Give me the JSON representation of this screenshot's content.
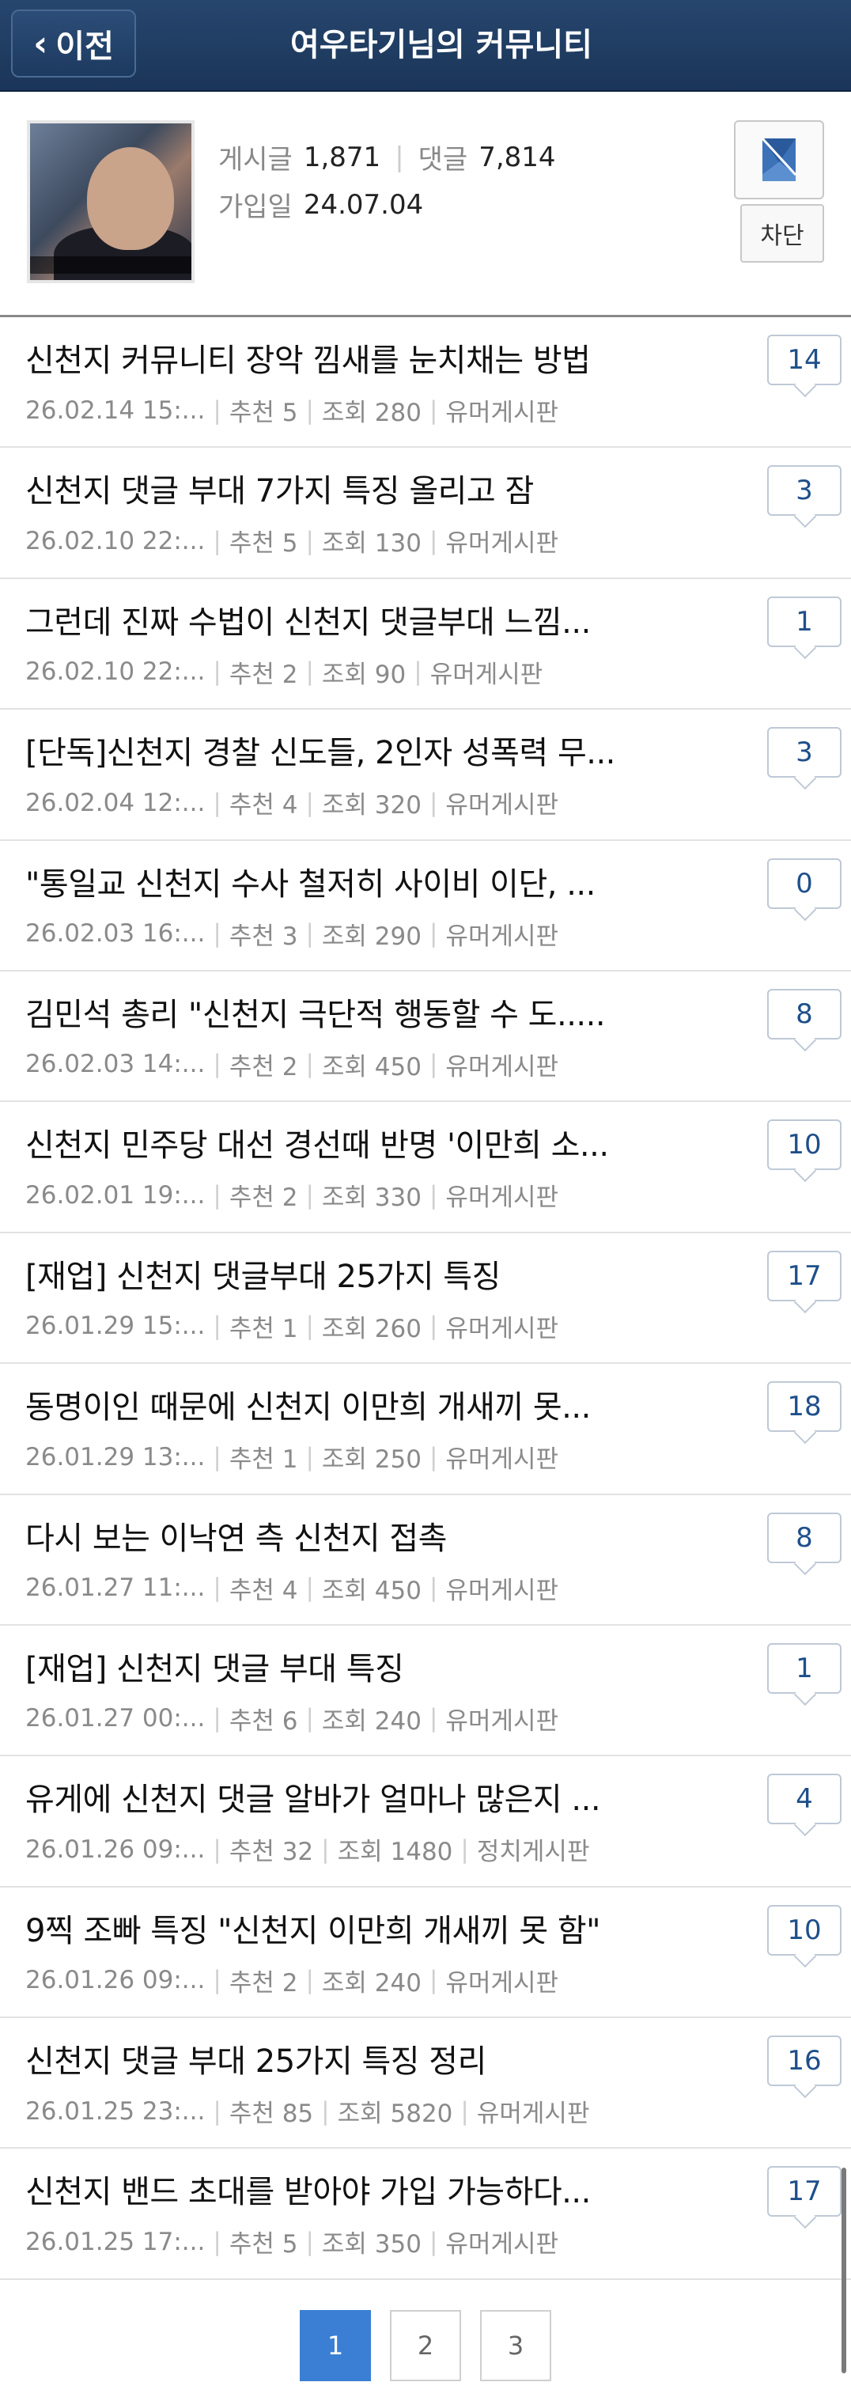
{
  "header": {
    "back_label": "이전",
    "title": "여우타기님의 커뮤니티"
  },
  "profile": {
    "posts_label": "게시글",
    "posts_count": "1,871",
    "comments_label": "댓글",
    "comments_count": "7,814",
    "joined_label": "가입일",
    "joined_date": "24.07.04",
    "block_label": "차단"
  },
  "posts": [
    {
      "title": "신천지 커뮤니티 장악 낌새를 눈치채는 방법",
      "date": "26.02.14  15:...",
      "likes": "추천 5",
      "views": "조회 280",
      "board": "유머게시판",
      "comments": "14"
    },
    {
      "title": "신천지 댓글 부대 7가지 특징 올리고 잠",
      "date": "26.02.10  22:...",
      "likes": "추천 5",
      "views": "조회 130",
      "board": "유머게시판",
      "comments": "3"
    },
    {
      "title": "그런데 진짜 수법이 신천지 댓글부대 느낌...",
      "date": "26.02.10  22:...",
      "likes": "추천 2",
      "views": "조회 90",
      "board": "유머게시판",
      "comments": "1"
    },
    {
      "title": "[단독]신천지 경찰 신도들, 2인자 성폭력 무...",
      "date": "26.02.04  12:...",
      "likes": "추천 4",
      "views": "조회 320",
      "board": "유머게시판",
      "comments": "3"
    },
    {
      "title": "\"통일교 신천지 수사 철저히 사이비 이단, ...",
      "date": "26.02.03  16:...",
      "likes": "추천 3",
      "views": "조회 290",
      "board": "유머게시판",
      "comments": "0"
    },
    {
      "title": "김민석 총리 \"신천지 극단적 행동할 수 도.....",
      "date": "26.02.03  14:...",
      "likes": "추천 2",
      "views": "조회 450",
      "board": "유머게시판",
      "comments": "8"
    },
    {
      "title": "신천지 민주당 대선 경선때 반명 '이만희 소...",
      "date": "26.02.01  19:...",
      "likes": "추천 2",
      "views": "조회 330",
      "board": "유머게시판",
      "comments": "10"
    },
    {
      "title": "[재업] 신천지 댓글부대 25가지 특징",
      "date": "26.01.29  15:...",
      "likes": "추천 1",
      "views": "조회 260",
      "board": "유머게시판",
      "comments": "17"
    },
    {
      "title": "동명이인 때문에 신천지 이만희 개새끼 못...",
      "date": "26.01.29  13:...",
      "likes": "추천 1",
      "views": "조회 250",
      "board": "유머게시판",
      "comments": "18"
    },
    {
      "title": "다시 보는 이낙연 측 신천지 접촉",
      "date": "26.01.27  11:...",
      "likes": "추천 4",
      "views": "조회 450",
      "board": "유머게시판",
      "comments": "8"
    },
    {
      "title": "[재업] 신천지 댓글 부대 특징",
      "date": "26.01.27  00:...",
      "likes": "추천 6",
      "views": "조회 240",
      "board": "유머게시판",
      "comments": "1"
    },
    {
      "title": "유게에 신천지 댓글 알바가 얼마나 많은지 ...",
      "date": "26.01.26  09:...",
      "likes": "추천 32",
      "views": "조회 1480",
      "board": "정치게시판",
      "comments": "4"
    },
    {
      "title": "9찍 조빠 특징 \"신천지 이만희 개새끼 못 함\"",
      "date": "26.01.26  09:...",
      "likes": "추천 2",
      "views": "조회 240",
      "board": "유머게시판",
      "comments": "10"
    },
    {
      "title": "신천지 댓글 부대 25가지 특징 정리",
      "date": "26.01.25  23:...",
      "likes": "추천 85",
      "views": "조회 5820",
      "board": "유머게시판",
      "comments": "16"
    },
    {
      "title": "신천지 밴드 초대를 받아야 가입 가능하다...",
      "date": "26.01.25  17:...",
      "likes": "추천 5",
      "views": "조회 350",
      "board": "유머게시판",
      "comments": "17"
    }
  ],
  "pagination": {
    "pages": [
      "1",
      "2",
      "3"
    ],
    "current": "1"
  },
  "colors": {
    "header_bg": "#1e3a5f",
    "accent": "#3b7fd4",
    "comment_count": "#1e4f8a"
  }
}
